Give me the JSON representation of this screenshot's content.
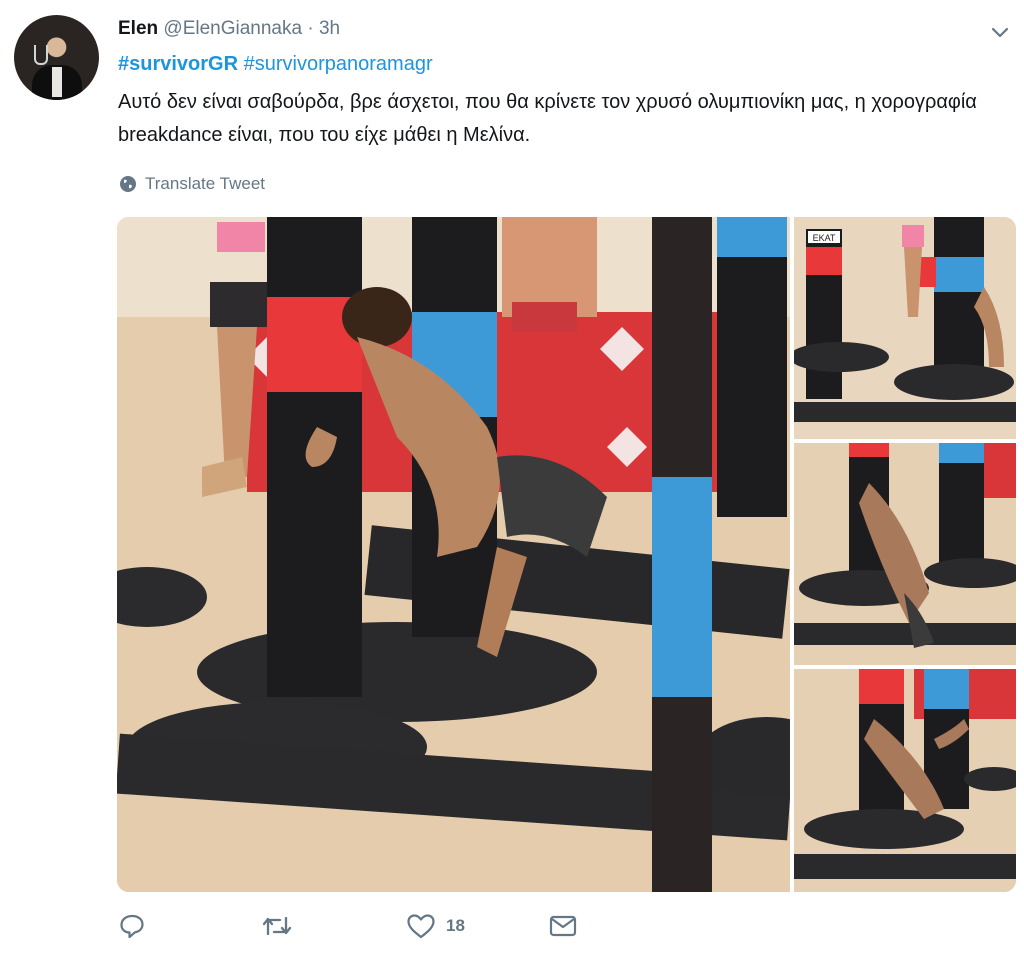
{
  "tweet": {
    "name": "Elen",
    "handle": "@ElenGiannaka",
    "separator": "·",
    "time": "3h",
    "hashtags": [
      "#survivorGR",
      "#survivorpanoramagr"
    ],
    "text": "Αυτό δεν είναι σαβούρδα, βρε άσχετοι, που θα κρίνετε τον χρυσό ολυμπιονίκη μας, η χορογραφία breakdance είναι, που του είχε μάθει η Μελίνα.",
    "translate_label": "Translate Tweet"
  },
  "media": {
    "logo_text": "EKAT"
  },
  "actions": {
    "reply_icon": "reply-icon",
    "retweet_icon": "retweet-icon",
    "like_icon": "heart-icon",
    "like_count": "18",
    "dm_icon": "mail-icon"
  },
  "colors": {
    "link": "#1b95e0",
    "muted": "#657786",
    "pole_black": "#1c1c1e",
    "pole_red": "#e8383a",
    "pole_blue": "#3d9ad6",
    "sand": "#e3c8a6"
  }
}
